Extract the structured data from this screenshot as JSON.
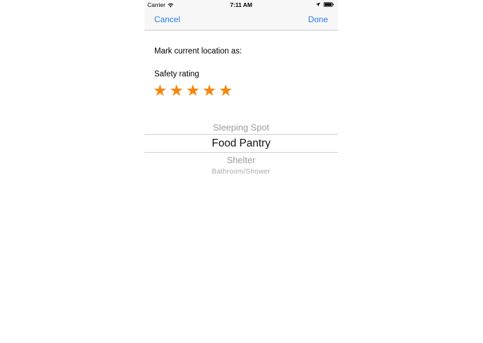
{
  "status_bar": {
    "carrier": "Carrier",
    "time": "7:11 AM"
  },
  "nav": {
    "cancel_label": "Cancel",
    "done_label": "Done"
  },
  "form": {
    "mark_label": "Mark current location as:",
    "safety_label": "Safety rating",
    "safety_rating": 5,
    "safety_max": 5
  },
  "picker": {
    "items": [
      "Sleeping Spot",
      "Food Pantry",
      "Shelter",
      "Bathroom/Shower"
    ],
    "selected": "Food Pantry"
  },
  "colors": {
    "accent": "#2a7ae2",
    "star": "#f5870e"
  }
}
